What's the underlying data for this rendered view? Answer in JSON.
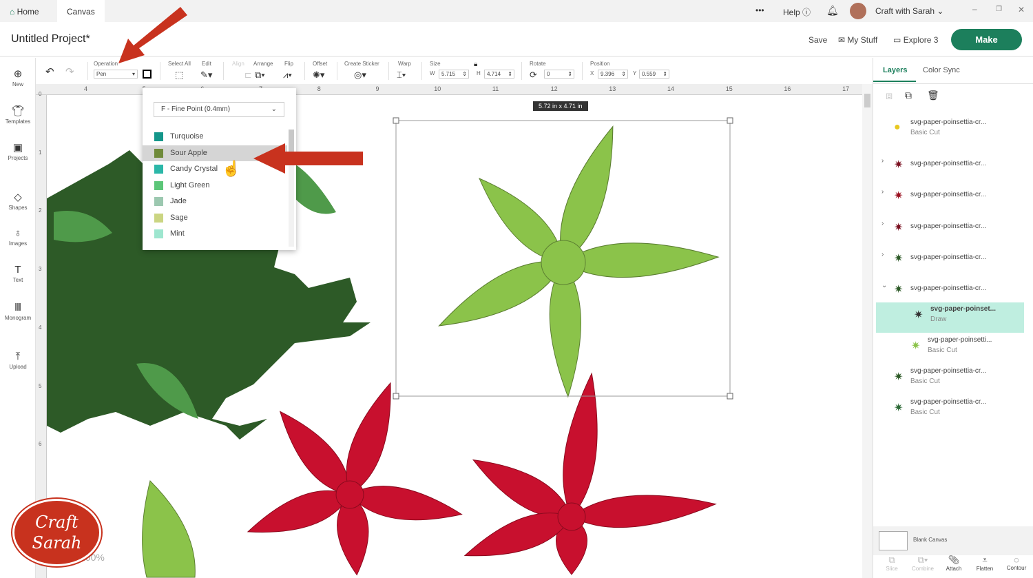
{
  "topbar": {
    "home": "Home",
    "canvas": "Canvas",
    "more": "•••",
    "help": "Help",
    "user": "Craft with Sarah"
  },
  "header": {
    "title": "Untitled Project*",
    "save": "Save",
    "my_stuff": "My Stuff",
    "machine": "Explore 3",
    "make": "Make"
  },
  "toolbar": {
    "operation_label": "Operation",
    "operation_value": "Pen",
    "select_all": "Select All",
    "edit": "Edit",
    "align": "Align",
    "arrange": "Arrange",
    "flip": "Flip",
    "offset": "Offset",
    "create_sticker": "Create Sticker",
    "warp": "Warp",
    "size": "Size",
    "w_label": "W",
    "w": "5.715",
    "h_label": "H",
    "h": "4.714",
    "rotate": "Rotate",
    "rotate_value": "0",
    "position": "Position",
    "x_label": "X",
    "x": "9.396",
    "y_label": "Y",
    "y": "0.559"
  },
  "sidebar": [
    "New",
    "Templates",
    "Projects",
    "Shapes",
    "Images",
    "Text",
    "Monogram",
    "Upload"
  ],
  "ruler": {
    "top": [
      "4",
      "5",
      "6",
      "7",
      "8",
      "9",
      "10",
      "11",
      "12",
      "13",
      "14",
      "15",
      "16",
      "17"
    ],
    "left": [
      "0",
      "1",
      "2",
      "3",
      "4",
      "5",
      "6"
    ]
  },
  "dropdown": {
    "pen": "F - Fine Point (0.4mm)",
    "colors": [
      {
        "name": "Turquoise",
        "hex": "#14968a"
      },
      {
        "name": "Sour Apple",
        "hex": "#6f8a3a"
      },
      {
        "name": "Candy Crystal",
        "hex": "#2bb7a8"
      },
      {
        "name": "Light Green",
        "hex": "#5cc678"
      },
      {
        "name": "Jade",
        "hex": "#9cc8b0"
      },
      {
        "name": "Sage",
        "hex": "#cbd582"
      },
      {
        "name": "Mint",
        "hex": "#9ee6cf"
      }
    ],
    "selected": "Sour Apple"
  },
  "selection": {
    "size_badge": "5.72  in x 4.71  in"
  },
  "rpanel": {
    "tabs": [
      "Layers",
      "Color Sync"
    ],
    "layers": [
      {
        "name": "svg-paper-poinsettia-cr...",
        "op": "Basic Cut"
      },
      {
        "name": "svg-paper-poinsettia-cr...",
        "op": ""
      },
      {
        "name": "svg-paper-poinsettia-cr...",
        "op": ""
      },
      {
        "name": "svg-paper-poinsettia-cr...",
        "op": ""
      },
      {
        "name": "svg-paper-poinsettia-cr...",
        "op": ""
      },
      {
        "name": "svg-paper-poinsettia-cr...",
        "op": ""
      },
      {
        "name": "svg-paper-poinset...",
        "op": "Draw"
      },
      {
        "name": "svg-paper-poinsetti...",
        "op": "Basic Cut"
      },
      {
        "name": "svg-paper-poinsettia-cr...",
        "op": "Basic Cut"
      },
      {
        "name": "svg-paper-poinsettia-cr...",
        "op": "Basic Cut"
      }
    ],
    "blank_canvas": "Blank Canvas",
    "bottom": [
      "Slice",
      "Combine",
      "Attach",
      "Flatten",
      "Contour"
    ]
  },
  "logo": {
    "text": "Craft with Sarah"
  },
  "zoom": "100%",
  "colors": {
    "accent": "#1c7f5c",
    "arrow": "#c8321e",
    "green_leaf": "#8bc34a",
    "dark_green": "#2d5a27",
    "red": "#c8102e"
  }
}
